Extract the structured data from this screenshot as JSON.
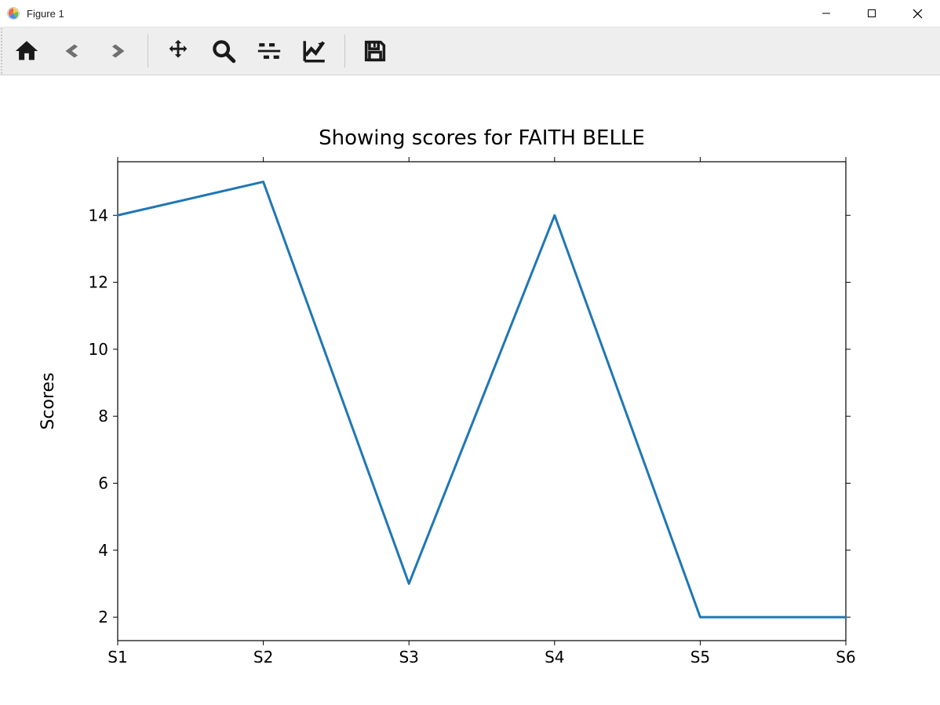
{
  "window": {
    "title": "Figure 1"
  },
  "toolbar": {
    "home": "Home",
    "back": "Back",
    "forward": "Forward",
    "pan": "Pan",
    "zoom": "Zoom",
    "subplots": "Configure subplots",
    "axes": "Edit axis",
    "save": "Save"
  },
  "chart_data": {
    "type": "line",
    "title": "Showing scores for FAITH BELLE",
    "xlabel": "",
    "ylabel": "Scores",
    "categories": [
      "S1",
      "S2",
      "S3",
      "S4",
      "S5",
      "S6"
    ],
    "values": [
      14,
      15,
      3,
      14,
      2,
      2
    ],
    "yticks": [
      2,
      4,
      6,
      8,
      10,
      12,
      14
    ],
    "ylim": [
      1.3,
      15.6
    ],
    "line_color": "#1f77b4"
  }
}
